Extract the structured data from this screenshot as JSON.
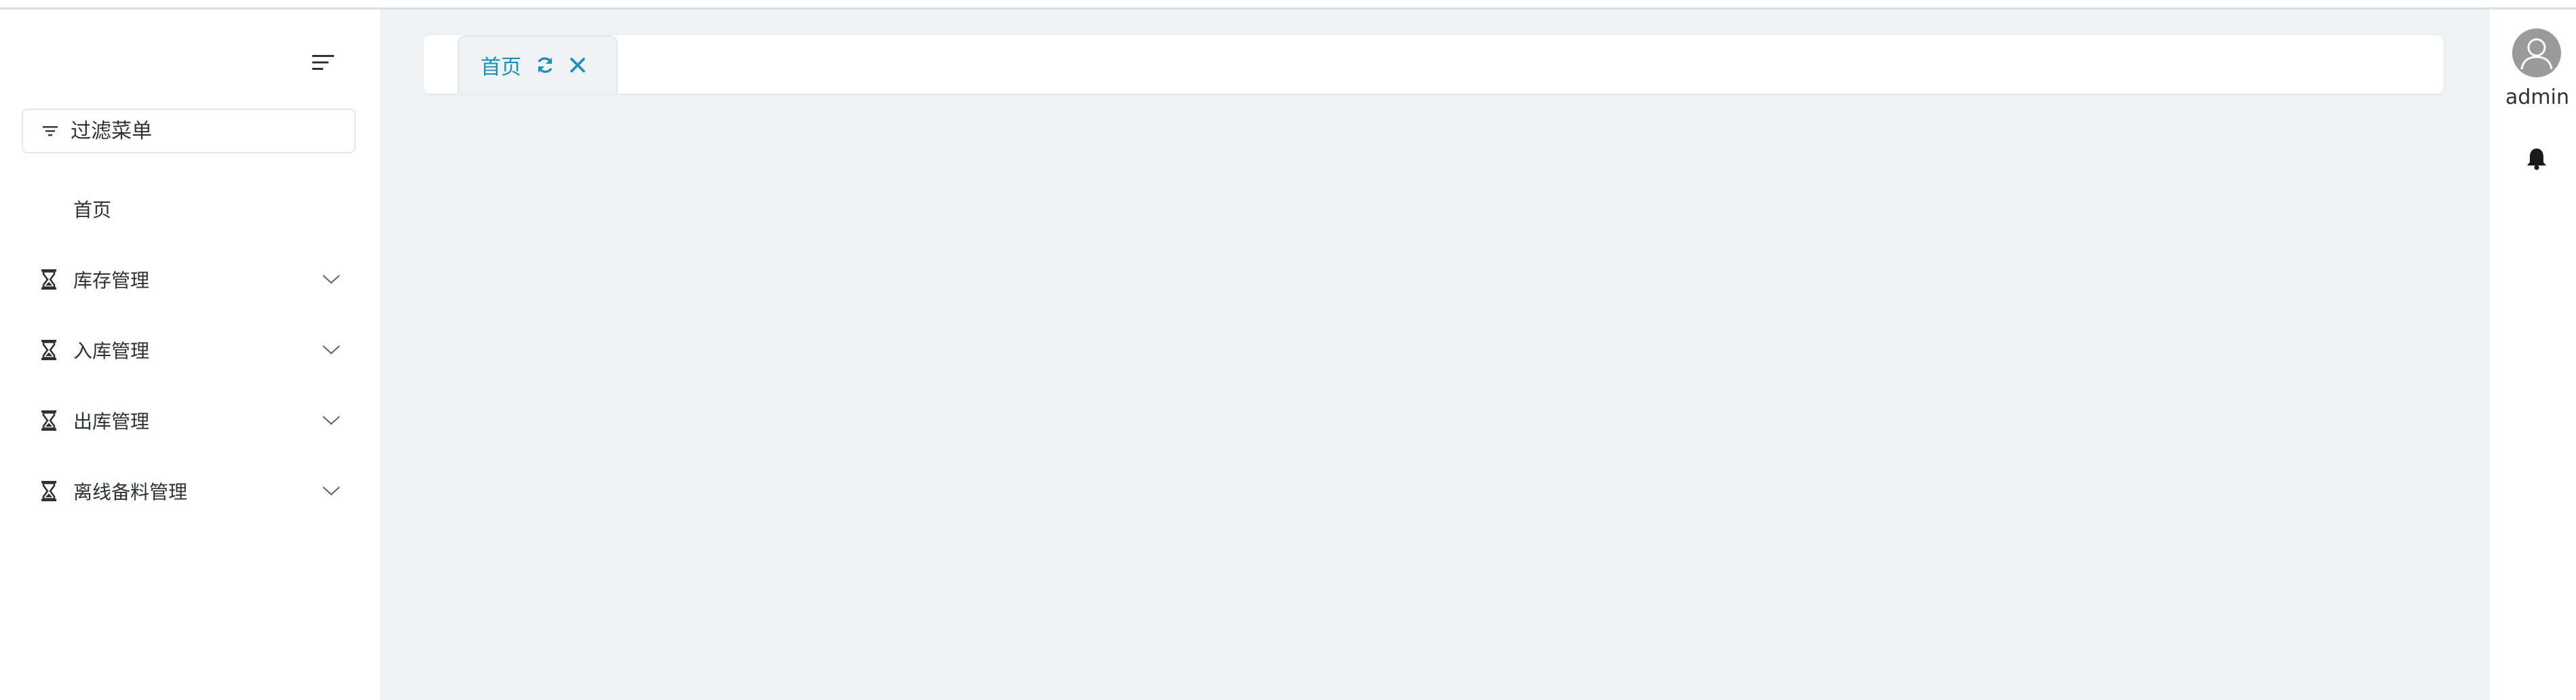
{
  "sidebar": {
    "filter_placeholder": "过滤菜单",
    "items": [
      {
        "label": "首页",
        "icon": "none",
        "has_children": false
      },
      {
        "label": "库存管理",
        "icon": "hourglass-icon",
        "has_children": true
      },
      {
        "label": "入库管理",
        "icon": "hourglass-icon",
        "has_children": true
      },
      {
        "label": "出库管理",
        "icon": "hourglass-icon",
        "has_children": true
      },
      {
        "label": "离线备料管理",
        "icon": "hourglass-icon",
        "has_children": true
      }
    ]
  },
  "tabs": [
    {
      "label": "首页",
      "active": true
    }
  ],
  "header": {
    "username": "admin"
  },
  "colors": {
    "accent": "#1890b8",
    "main_bg": "#eef2f5",
    "avatar_bg": "#9a9a9a"
  }
}
